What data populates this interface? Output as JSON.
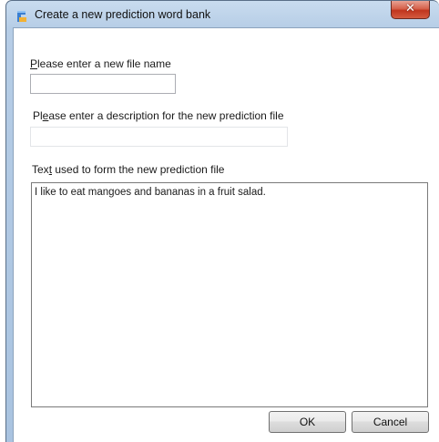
{
  "window": {
    "title": "Create a new prediction word bank",
    "close_label": "✕"
  },
  "form": {
    "file_name": {
      "label_before": "",
      "label_accel": "P",
      "label_after": "lease enter a new file name",
      "value": ""
    },
    "description": {
      "label_before": "Pl",
      "label_accel": "e",
      "label_after": "ase enter a description for the new prediction file",
      "value": ""
    },
    "text": {
      "label_before": "Tex",
      "label_accel": "t",
      "label_after": " used to form the new prediction file",
      "value": "I like to eat mangoes and bananas in a fruit salad."
    }
  },
  "buttons": {
    "ok_label": "OK",
    "cancel_label": "Cancel"
  },
  "icons": {
    "app": "prediction-app-icon",
    "close": "close-icon"
  }
}
